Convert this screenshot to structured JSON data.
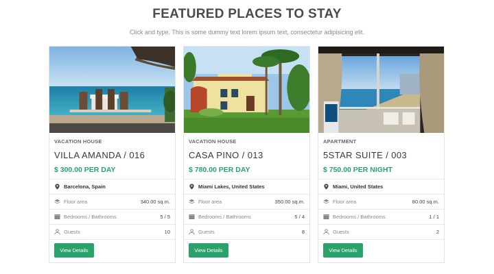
{
  "header": {
    "title": "FEATURED PLACES TO STAY",
    "subtitle": "Click and type. This is some dummy text lorem ipsum text, consectetur adipisicing elit."
  },
  "cards": [
    {
      "category": "VACATION HOUSE",
      "name": "VILLA AMANDA / 016",
      "price": "$ 300.00 PER DAY",
      "location": "Barcelona, Spain",
      "floor_label": "Floor area",
      "floor_value": "340.00 sq.m.",
      "bed_label": "Bedrooms / Bathrooms",
      "bed_value": "5 / 5",
      "guests_label": "Guests",
      "guests_value": "10",
      "button": "View Details"
    },
    {
      "category": "VACATION HOUSE",
      "name": "CASA PINO / 013",
      "price": "$ 780.00 PER DAY",
      "location": "Miami Lakes, United States",
      "floor_label": "Floor area",
      "floor_value": "350.00 sq.m.",
      "bed_label": "Bedrooms / Bathrooms",
      "bed_value": "5 / 4",
      "guests_label": "Guests",
      "guests_value": "8",
      "button": "View Details"
    },
    {
      "category": "APARTMENT",
      "name": "5STAR SUITE / 003",
      "price": "$ 750.00 PER NIGHT",
      "location": "Miami, United States",
      "floor_label": "Floor area",
      "floor_value": "80.00 sq.m.",
      "bed_label": "Bedrooms / Bathrooms",
      "bed_value": "1 / 1",
      "guests_label": "Guests",
      "guests_value": "2",
      "button": "View Details"
    }
  ],
  "icons": {
    "location": "map-pin-icon",
    "floor": "layers-icon",
    "bedrooms": "bed-icon",
    "guests": "user-icon"
  },
  "colors": {
    "accent": "#2aa36b",
    "title": "#4a4a4a",
    "border": "#e3e3e3"
  }
}
